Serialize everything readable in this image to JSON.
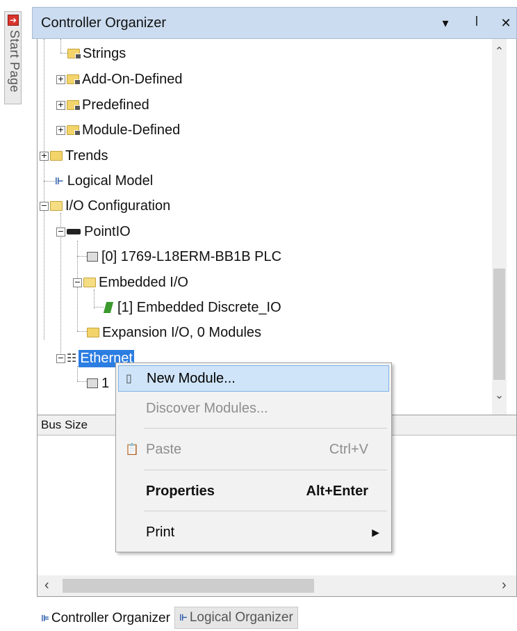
{
  "start_page_tab": {
    "label": "Start Page"
  },
  "panel": {
    "title": "Controller Organizer",
    "dropdown_icon": "▾",
    "pin_icon": "🖈",
    "close_icon": "✕"
  },
  "tree": {
    "strings": "Strings",
    "add_on_defined": "Add-On-Defined",
    "predefined": "Predefined",
    "module_defined": "Module-Defined",
    "trends": "Trends",
    "logical_model": "Logical Model",
    "io_configuration": "I/O Configuration",
    "pointio": "PointIO",
    "plc": "[0] 1769-L18ERM-BB1B PLC",
    "embedded_io": "Embedded I/O",
    "embedded_discrete": "[1] Embedded Discrete_IO",
    "expansion_io": "Expansion I/O, 0 Modules",
    "ethernet": "Ethernet",
    "ethernet_child_partial": "1"
  },
  "properties": {
    "column_header": "Bus Size"
  },
  "context_menu": {
    "new_module": "New Module...",
    "discover_modules": "Discover Modules...",
    "paste": "Paste",
    "paste_shortcut": "Ctrl+V",
    "properties": "Properties",
    "properties_shortcut": "Alt+Enter",
    "print": "Print"
  },
  "bottom_tabs": {
    "controller_organizer": "Controller Organizer",
    "logical_organizer": "Logical Organizer"
  },
  "colors": {
    "header_bg": "#cbdcf0",
    "selection": "#2b7de1",
    "menu_highlight": "#cfe4f8"
  }
}
